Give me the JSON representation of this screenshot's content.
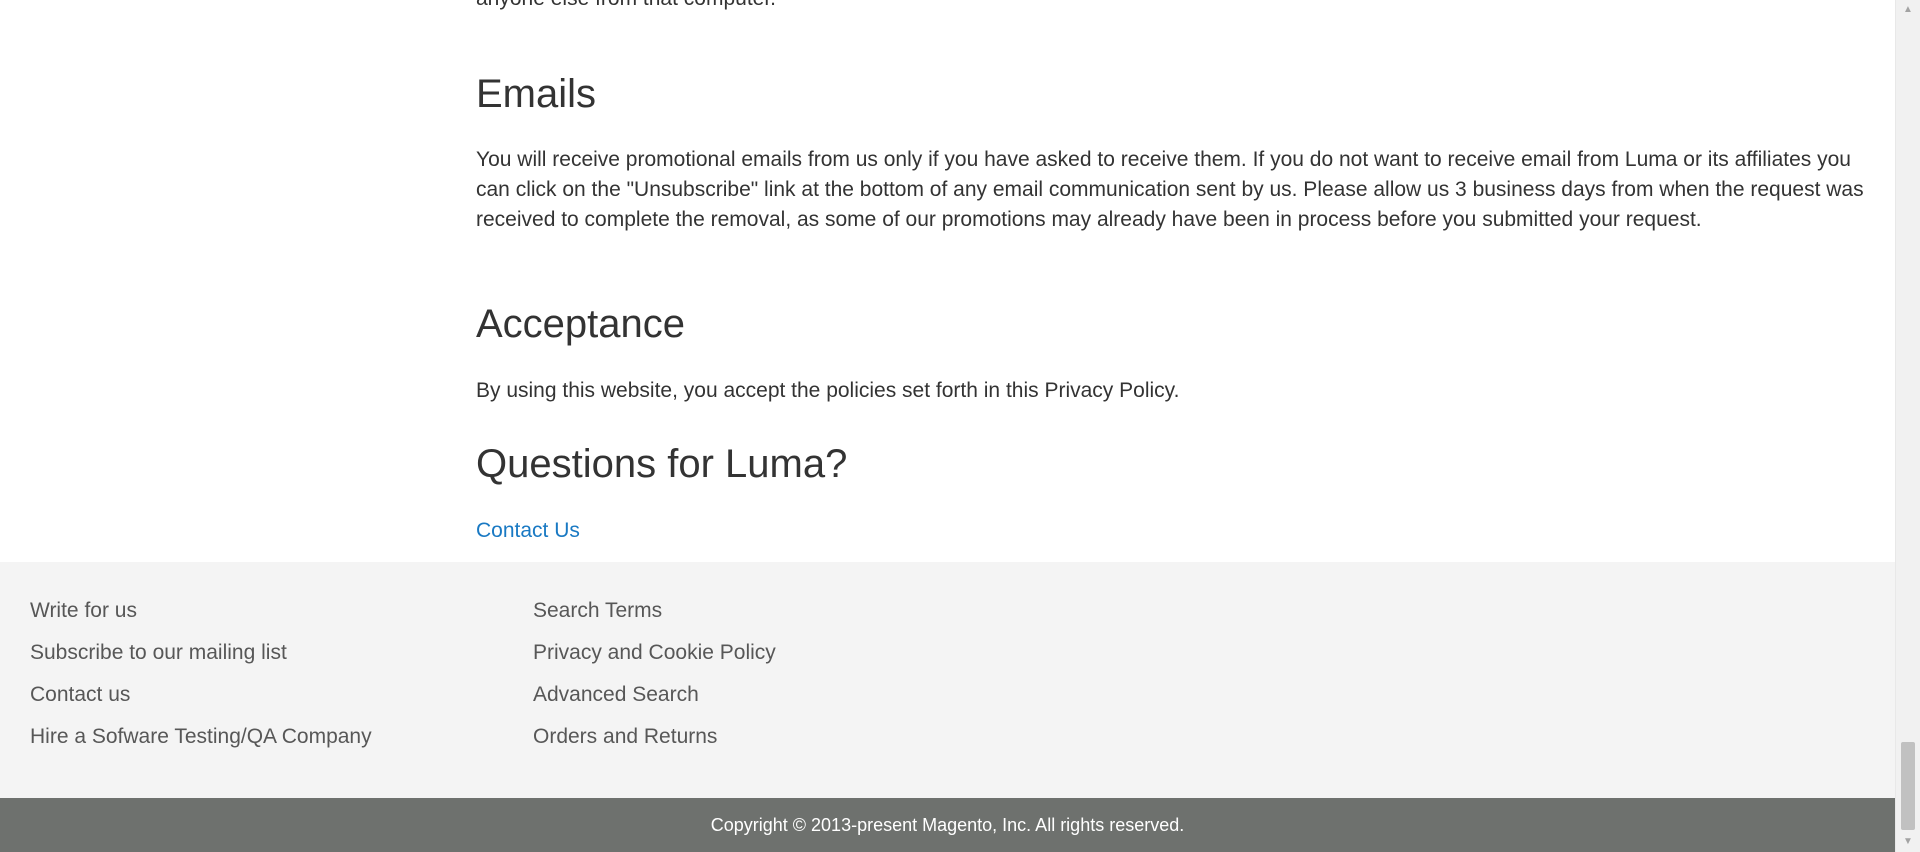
{
  "content": {
    "top_paragraph_tail": "anyone else from that computer.",
    "emails_heading": "Emails",
    "emails_paragraph": "You will receive promotional emails from us only if you have asked to receive them. If you do not want to receive email from Luma or its affiliates you can click on the \"Unsubscribe\" link at the bottom of any email communication sent by us. Please allow us 3 business days from when the request was received to complete the removal, as some of our promotions may already have been in process before you submitted your request.",
    "acceptance_heading": "Acceptance",
    "acceptance_paragraph": "By using this website, you accept the policies set forth in this Privacy Policy.",
    "questions_heading": "Questions for Luma?",
    "contact_link": "Contact Us"
  },
  "footer": {
    "column_1": [
      {
        "label": "Write for us"
      },
      {
        "label": "Subscribe to our mailing list"
      },
      {
        "label": "Contact us"
      },
      {
        "label": "Hire a Sofware Testing/QA Company"
      }
    ],
    "column_2": [
      {
        "label": "Search Terms"
      },
      {
        "label": "Privacy and Cookie Policy"
      },
      {
        "label": "Advanced Search"
      },
      {
        "label": "Orders and Returns"
      }
    ],
    "copyright": "Copyright © 2013-present Magento, Inc. All rights reserved."
  },
  "scrollbar": {
    "up_icon": "arrow-up-icon",
    "down_icon": "arrow-down-icon"
  },
  "colors": {
    "link": "#1979c3",
    "footer_bg": "#f4f4f4",
    "copyright_bg": "#6e716e"
  }
}
